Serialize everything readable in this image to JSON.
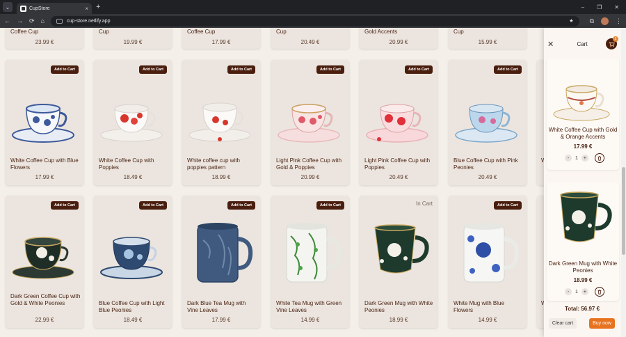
{
  "browser": {
    "tab_title": "CupStore",
    "url": "cup-store.netlify.app",
    "new_tab": "+",
    "tab_close": "×",
    "minimize": "–",
    "restore": "❐",
    "close": "✕"
  },
  "nav": {
    "back": "←",
    "forward": "→",
    "reload": "⟳",
    "home": "⌂",
    "star": "★",
    "extensions": "⧉",
    "menu": "⋮",
    "tab_menu": "⌄"
  },
  "products": {
    "add_label": "Add to Cart",
    "in_cart_label": "In Cart",
    "row0": [
      {
        "name": "Coffee Cup",
        "price": "23.99 €"
      },
      {
        "name": "Cup",
        "price": "19.99 €"
      },
      {
        "name": "Coffee Cup",
        "price": "17.99 €"
      },
      {
        "name": "Cup",
        "price": "20.49 €"
      },
      {
        "name": "Gold Accents",
        "price": "20.99 €"
      },
      {
        "name": "Cup",
        "price": "15.99 €"
      }
    ],
    "row1": [
      {
        "name": "White Coffee Cup with Blue Flowers",
        "price": "17.99 €"
      },
      {
        "name": "White Coffee Cup with Poppies",
        "price": "18.49 €"
      },
      {
        "name": "White coffee cup with poppies pattern",
        "price": "18.99 €"
      },
      {
        "name": "Light Pink Coffee Cup with Gold & Poppies",
        "price": "20.99 €"
      },
      {
        "name": "Light Pink Coffee Cup with Poppies",
        "price": "20.49 €"
      },
      {
        "name": "Blue Coffee Cup with Pink Peonies",
        "price": "20.49 €"
      }
    ],
    "row2": [
      {
        "name": "Dark Green Coffee Cup with Gold & White Peonies",
        "price": "22.99 €"
      },
      {
        "name": "Blue Coffee Cup with Light Blue Peonies",
        "price": "18.49 €"
      },
      {
        "name": "Dark Blue Tea Mug with Vine Leaves",
        "price": "17.99 €"
      },
      {
        "name": "White Tea Mug with Green Vine Leaves",
        "price": "14.99 €"
      },
      {
        "name": "Dark Green Mug with White Peonies",
        "price": "18.99 €"
      },
      {
        "name": "White Mug with Blue Flowers",
        "price": "14.99 €"
      }
    ],
    "partial_col": {
      "row1": "W",
      "row2": "W"
    }
  },
  "cart": {
    "title": "Cart",
    "close": "✕",
    "badge": "2",
    "items": [
      {
        "name": "White Coffee Cup with Gold & Orange Accents",
        "price": "17.99 €",
        "qty": "1"
      },
      {
        "name": "Dark Green Mug with White Peonies",
        "price": "18.99 €",
        "qty": "1"
      }
    ],
    "minus": "-",
    "plus": "+",
    "total": "Total: 56.97 €",
    "clear": "Clear cart",
    "buy": "Buy now"
  },
  "colors": {
    "brown": "#4a1e0e",
    "orange": "#e8731f",
    "card_bg": "#ece5df"
  }
}
